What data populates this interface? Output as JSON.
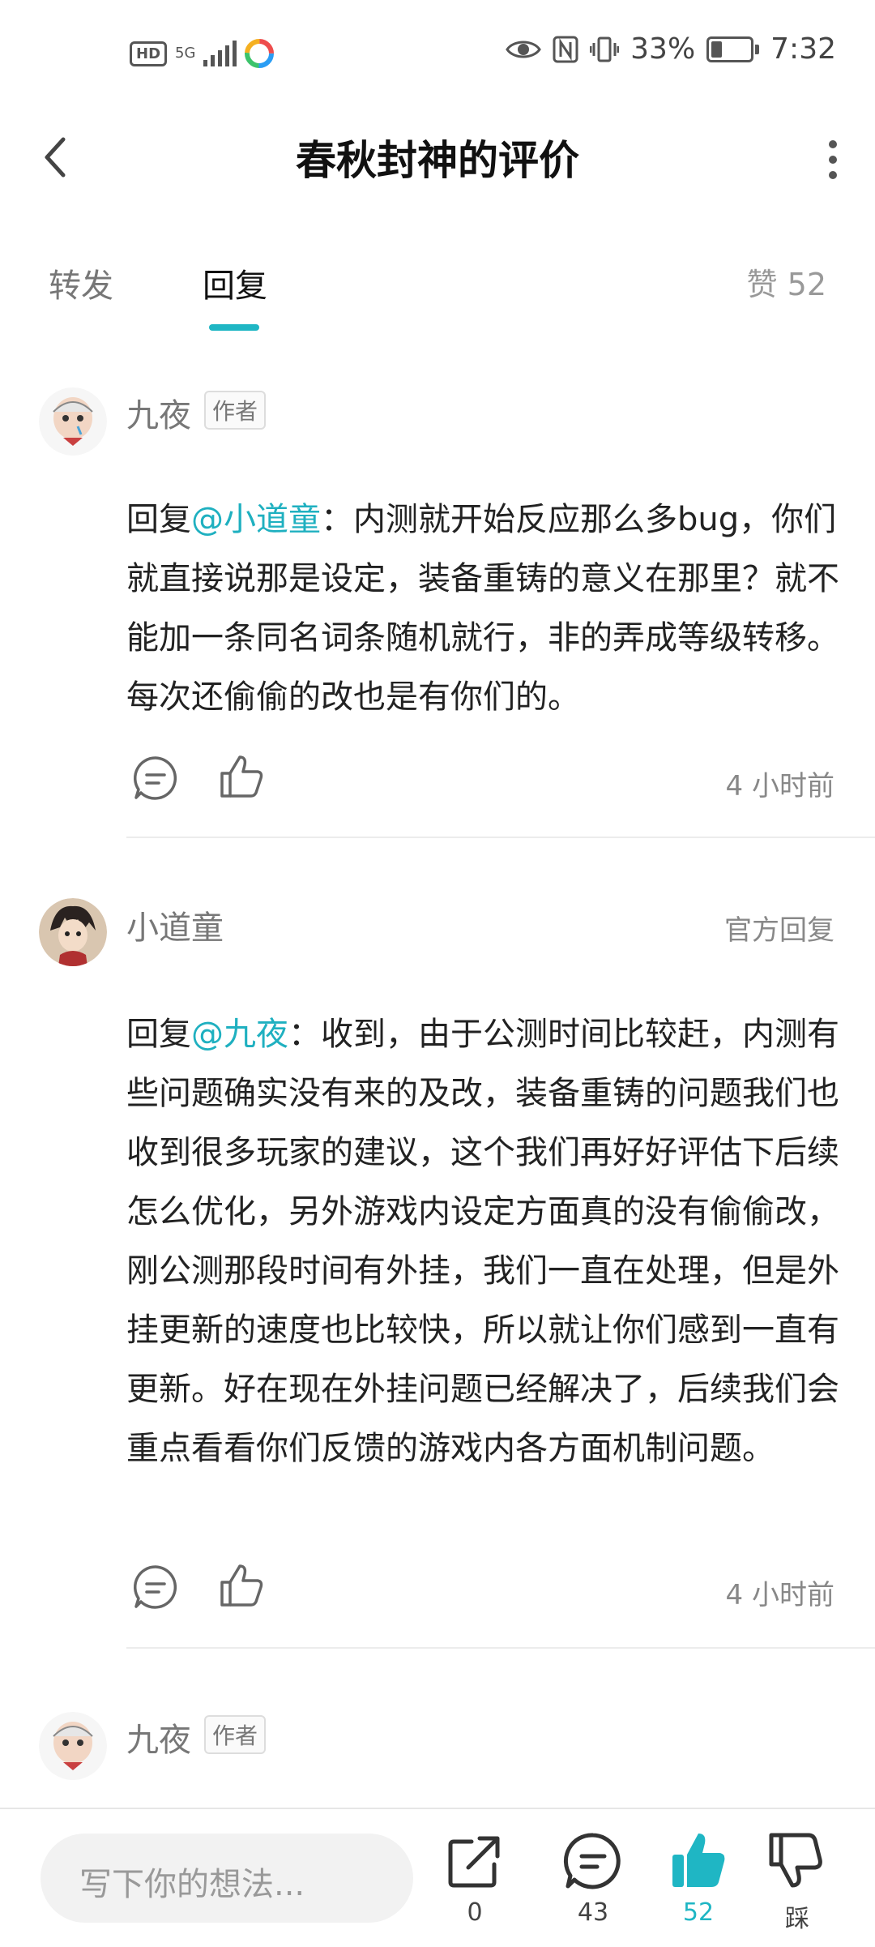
{
  "status_bar": {
    "hd": "HD",
    "network": "5G",
    "battery_percent": "33%",
    "time": "7:32",
    "battery_level": 0.33
  },
  "header": {
    "title": "春秋封神的评价"
  },
  "tabs": {
    "forward": "转发",
    "reply": "回复",
    "likes_label": "赞",
    "likes_count": "52"
  },
  "comments": [
    {
      "name": "九夜",
      "badge": "作者",
      "reply_prefix": "回复",
      "mention": "@小道童",
      "text": "：内测就开始反应那么多bug，你们就直接说那是设定，装备重铸的意义在那里？就不能加一条同名词条随机就行，非的弄成等级转移。每次还偷偷的改也是有你们的。",
      "time": "4 小时前"
    },
    {
      "name": "小道童",
      "official": "官方回复",
      "reply_prefix": "回复",
      "mention": "@九夜",
      "text": "：收到，由于公测时间比较赶，内测有些问题确实没有来的及改，装备重铸的问题我们也收到很多玩家的建议，这个我们再好好评估下后续怎么优化，另外游戏内设定方面真的没有偷偷改，刚公测那段时间有外挂，我们一直在处理，但是外挂更新的速度也比较快，所以就让你们感到一直有更新。好在现在外挂问题已经解决了，后续我们会重点看看你们反馈的游戏内各方面机制问题。",
      "time": "4 小时前"
    },
    {
      "name": "九夜",
      "badge": "作者"
    }
  ],
  "bottom_bar": {
    "input_placeholder": "写下你的想法...",
    "share_count": "0",
    "comment_count": "43",
    "like_count": "52",
    "dislike_label": "踩"
  },
  "colors": {
    "accent": "#1fb6c4"
  }
}
